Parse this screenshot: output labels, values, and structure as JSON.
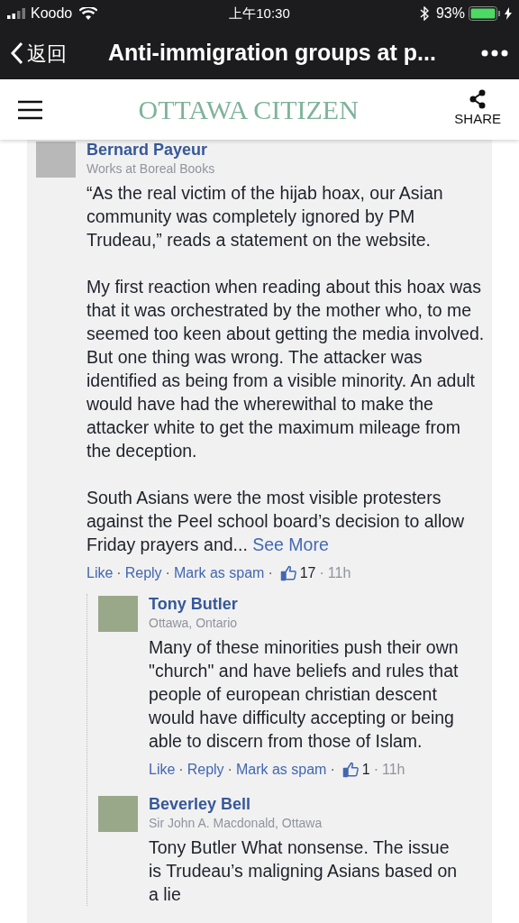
{
  "status_bar": {
    "carrier": "Koodo",
    "time": "上午10:30",
    "battery": "93%"
  },
  "nav": {
    "back": "返回",
    "title": "Anti-immigration groups at p..."
  },
  "site_header": {
    "logo": "OTTAWA CITIZEN",
    "share": "SHARE"
  },
  "comments": [
    {
      "name": "Bernard Payeur",
      "subtitle": "Works at Boreal Books",
      "paragraphs": [
        "“As the real victim of the hijab hoax, our Asian community was completely ignored by PM Trudeau,” reads a statement on the website.",
        "My first reaction when reading about this hoax was that it was orchestrated by the mother who, to me seemed too keen about getting the media involved. But one thing was wrong. The attacker was identified as being from a visible minority. An adult would have had the wherewithal to make the attacker white to get the maximum mileage from the deception.",
        "South Asians were the most visible protesters against the Peel school board’s decision to allow Friday prayers and..."
      ],
      "see_more": "See More",
      "actions": [
        "Like",
        "Reply",
        "Mark as spam"
      ],
      "separator": "·",
      "likes": "17",
      "time": "11h",
      "replies": [
        {
          "name": "Tony Butler",
          "subtitle": "Ottawa, Ontario",
          "paragraphs": [
            "Many of these minorities push their own \"church\" and have beliefs and rules that people of european christian descent would have difficulty accepting or being able to discern from those of Islam."
          ],
          "actions": [
            "Like",
            "Reply",
            "Mark as spam"
          ],
          "separator": "·",
          "likes": "1",
          "time": "11h"
        },
        {
          "name": "Beverley Bell",
          "subtitle": "Sir John A. Macdonald, Ottawa",
          "paragraphs": [
            "Tony Butler What nonsense. The issue is Trudeau’s maligning Asians based on a lie"
          ]
        }
      ]
    }
  ]
}
